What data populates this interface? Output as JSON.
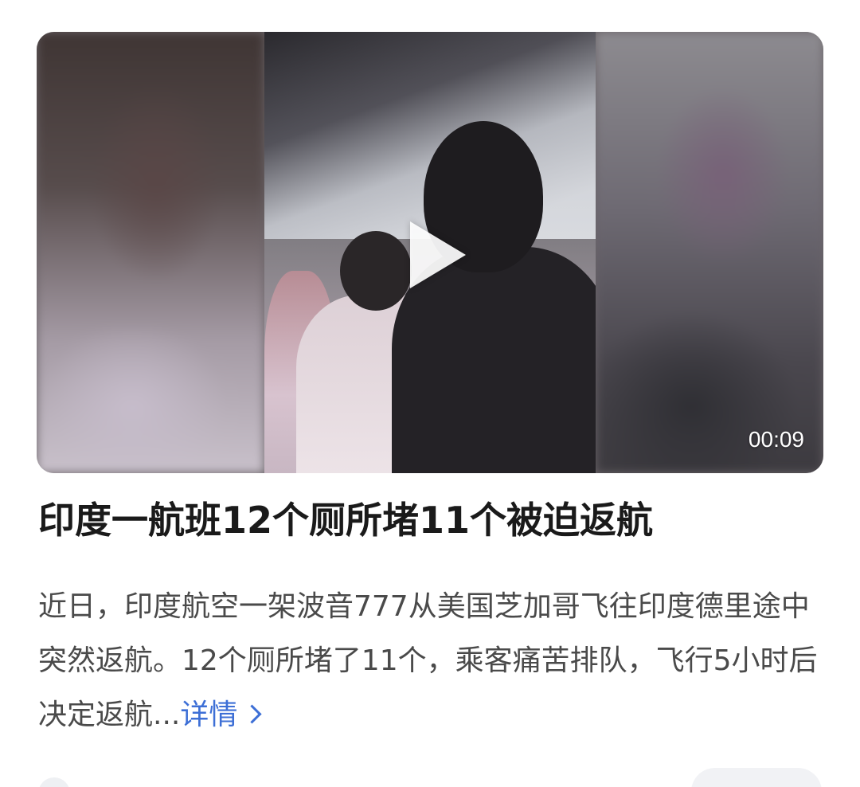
{
  "video": {
    "duration": "00:09"
  },
  "article": {
    "title": "印度一航班12个厕所堵11个被迫返航",
    "summary": "近日，印度航空一架波音777从美国芝加哥飞往印度德里途中突然返航。12个厕所堵了11个，乘客痛苦排队，飞行5小时后决定返航...",
    "more_label": "详情"
  },
  "colors": {
    "link": "#3d6fd6",
    "title": "#1a1a1a",
    "body": "#4a4a4a"
  },
  "icons": {
    "play": "play-icon",
    "chevron": "chevron-right-icon"
  }
}
